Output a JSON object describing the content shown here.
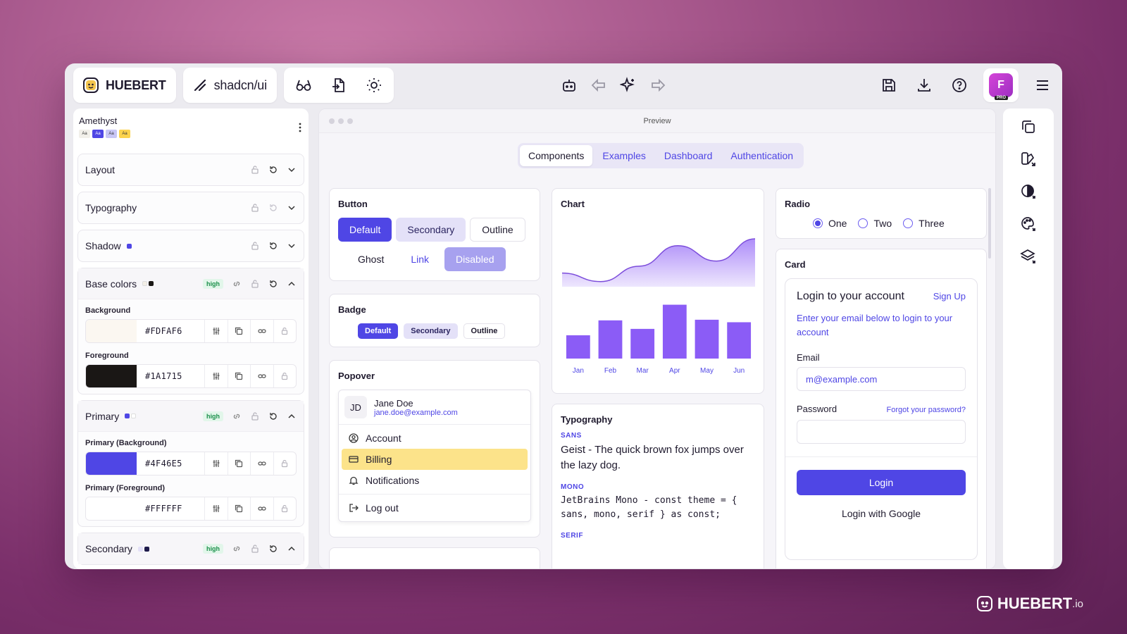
{
  "toolbar": {
    "brand": "HUEBERT",
    "library": "shadcn/ui",
    "avatar_initial": "F",
    "avatar_badge": "PRO"
  },
  "sidebar": {
    "theme_name": "Amethyst",
    "swatch_label": "Aa",
    "sections": {
      "layout": "Layout",
      "typography": "Typography",
      "shadow": "Shadow",
      "base_colors": "Base colors",
      "primary": "Primary",
      "secondary": "Secondary"
    },
    "contrast_badge": "high",
    "colors": {
      "background": {
        "label": "Background",
        "hex": "#FDFAF6"
      },
      "foreground": {
        "label": "Foreground",
        "hex": "#1A1715"
      },
      "primary_bg": {
        "label": "Primary (Background)",
        "hex": "#4F46E5"
      },
      "primary_fg": {
        "label": "Primary (Foreground)",
        "hex": "#FFFFFF"
      }
    }
  },
  "preview": {
    "title": "Preview",
    "tabs": [
      "Components",
      "Examples",
      "Dashboard",
      "Authentication"
    ],
    "button_card": {
      "title": "Button",
      "default": "Default",
      "secondary": "Secondary",
      "outline": "Outline",
      "ghost": "Ghost",
      "link": "Link",
      "disabled": "Disabled"
    },
    "badge_card": {
      "title": "Badge",
      "default": "Default",
      "secondary": "Secondary",
      "outline": "Outline"
    },
    "popover_card": {
      "title": "Popover",
      "initials": "JD",
      "name": "Jane Doe",
      "email": "jane.doe@example.com",
      "items": [
        "Account",
        "Billing",
        "Notifications",
        "Log out"
      ]
    },
    "chart_card": {
      "title": "Chart"
    },
    "typography_card": {
      "title": "Typography",
      "sans_label": "SANS",
      "sans_sample": "Geist - The quick brown fox jumps over the lazy dog.",
      "mono_label": "MONO",
      "mono_sample": "JetBrains Mono - const theme = { sans, mono, serif } as const;",
      "serif_label": "SERIF"
    },
    "radio_card": {
      "title": "Radio",
      "options": [
        "One",
        "Two",
        "Three"
      ],
      "selected": "One"
    },
    "login_card": {
      "title": "Card",
      "heading": "Login to your account",
      "signup": "Sign Up",
      "description": "Enter your email below to login to your account",
      "email_label": "Email",
      "email_placeholder": "m@example.com",
      "password_label": "Password",
      "forgot": "Forgot your password?",
      "login": "Login",
      "login_google": "Login with Google"
    }
  },
  "footer_brand": {
    "name": "HUEBERT",
    "suffix": ".io"
  },
  "colors": {
    "primary": "#4F46E5",
    "secondary": "#E4E1F8",
    "accent_highlight": "#FCE38A",
    "chart_fill": "#8B5CF6"
  },
  "chart_data": {
    "type": "bar",
    "categories": [
      "Jan",
      "Feb",
      "Mar",
      "Apr",
      "May",
      "Jun"
    ],
    "values": [
      186,
      305,
      237,
      430,
      310,
      290
    ],
    "area_values": [
      80,
      30,
      120,
      240,
      150,
      280
    ],
    "ylim": [
      0,
      450
    ]
  }
}
